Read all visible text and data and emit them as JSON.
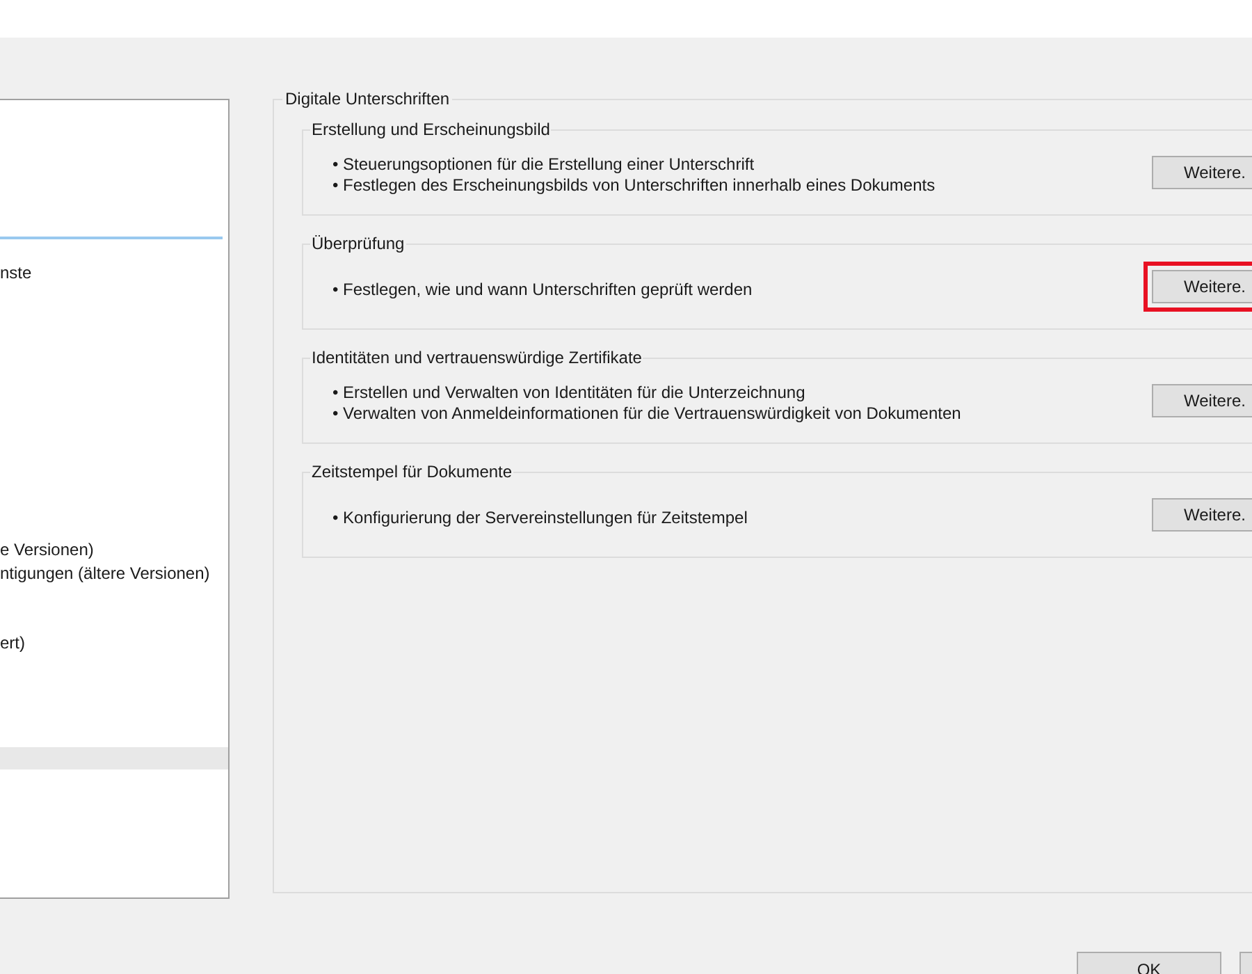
{
  "sidebar": {
    "items": [
      {
        "label": "nste",
        "selected": false
      },
      {
        "label": "e Versionen)",
        "selected": false
      },
      {
        "label": "ntigungen (ältere Versionen)",
        "selected": false
      },
      {
        "label": "ert)",
        "selected": false
      },
      {
        "selected": true
      }
    ]
  },
  "group": {
    "title": "Digitale Unterschriften",
    "sections": [
      {
        "title": "Erstellung und Erscheinungsbild",
        "bullets": [
          "• Steuerungsoptionen für die Erstellung einer Unterschrift",
          "• Festlegen des Erscheinungsbilds von Unterschriften innerhalb eines Dokuments"
        ],
        "button": "Weitere.",
        "highlighted": false
      },
      {
        "title": "Überprüfung",
        "bullets": [
          "• Festlegen, wie und wann Unterschriften geprüft werden"
        ],
        "button": "Weitere.",
        "highlighted": true
      },
      {
        "title": "Identitäten und vertrauenswürdige Zertifikate",
        "bullets": [
          "• Erstellen und Verwalten von Identitäten für die Unterzeichnung",
          "• Verwalten von Anmeldeinformationen für die Vertrauenswürdigkeit von Dokumenten"
        ],
        "button": "Weitere.",
        "highlighted": false
      },
      {
        "title": "Zeitstempel für Dokumente",
        "bullets": [
          "• Konfigurierung der Servereinstellungen für Zeitstempel"
        ],
        "button": "Weitere.",
        "highlighted": false
      }
    ]
  },
  "footer": {
    "buttons": [
      "OK"
    ]
  }
}
